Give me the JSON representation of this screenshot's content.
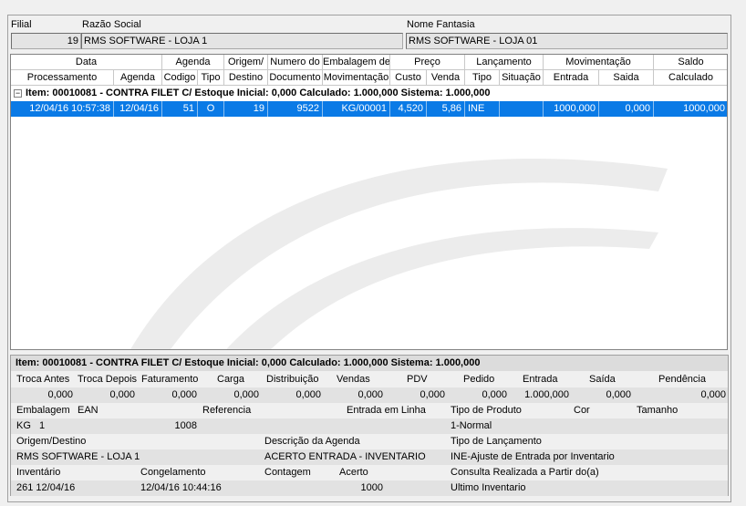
{
  "header": {
    "filial_label": "Filial",
    "filial_value": "19",
    "razao_label": "Razão Social",
    "razao_value": "RMS SOFTWARE - LOJA 1",
    "fantasia_label": "Nome Fantasia",
    "fantasia_value": "RMS SOFTWARE - LOJA 01"
  },
  "grid": {
    "top_headers": [
      "Data",
      "Agenda",
      "Origem/",
      "Numero do",
      "Embalagem de",
      "Preço",
      "Lançamento",
      "Movimentação",
      "Saldo"
    ],
    "sub_headers": [
      "Processamento",
      "Agenda",
      "Codigo",
      "Tipo",
      "Destino",
      "Documento",
      "Movimentação",
      "Custo",
      "Venda",
      "Tipo",
      "Situação",
      "Entrada",
      "Saida",
      "Calculado"
    ],
    "group_label": "Item: 00010081 - CONTRA FILET C/  Estoque Inicial: 0,000  Calculado: 1.000,000  Sistema: 1.000,000",
    "row": [
      "12/04/16 10:57:38",
      "12/04/16",
      "51",
      "O",
      "19",
      "9522",
      "KG/00001",
      "4,520",
      "5,86",
      "INE",
      "",
      "1000,000",
      "0,000",
      "1000,000"
    ]
  },
  "detail": {
    "title": "Item: 00010081 - CONTRA FILET C/  Estoque Inicial: 0,000  Calculado: 1.000,000  Sistema: 1.000,000",
    "stock_labels": [
      "Troca Antes",
      "Troca Depois",
      "Faturamento",
      "Carga",
      "Distribuição",
      "Vendas",
      "PDV",
      "Pedido",
      "Entrada",
      "Saída",
      "Pendência"
    ],
    "stock_values": [
      "0,000",
      "0,000",
      "0,000",
      "0,000",
      "0,000",
      "0,000",
      "0,000",
      "0,000",
      "1.000,000",
      "0,000",
      "0,000"
    ],
    "emb_labels": [
      "Embalagem",
      "EAN",
      "Referencia",
      "Entrada em Linha",
      "Tipo de Produto",
      "Cor",
      "Tamanho"
    ],
    "emb_values": [
      "KG   1",
      "1008",
      "1-Normal"
    ],
    "orig_labels": [
      "Origem/Destino",
      "Descrição da Agenda",
      "Tipo de Lançamento"
    ],
    "orig_values": [
      "RMS SOFTWARE - LOJA 1",
      "ACERTO ENTRADA - INVENTARIO",
      "INE-Ajuste de Entrada por Inventario"
    ],
    "inv_labels": [
      "Inventário",
      "Congelamento",
      "Contagem",
      "Acerto",
      "Consulta Realizada a Partir do(a)"
    ],
    "inv_values": [
      "261 12/04/16",
      "12/04/16 10:44:16",
      "1000",
      "Ultimo Inventario"
    ]
  }
}
